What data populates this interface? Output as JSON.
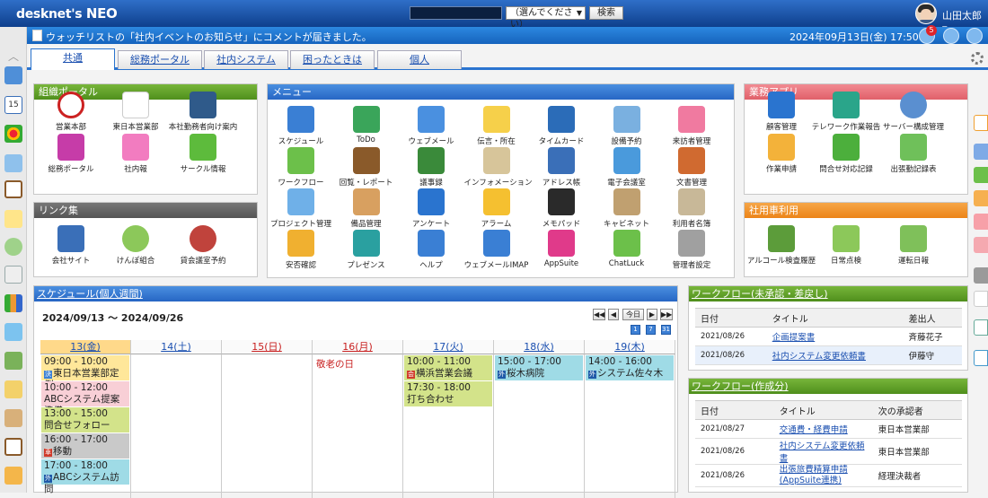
{
  "app": {
    "logo": "desknet's",
    "logo_neo": "NEO"
  },
  "search": {
    "select_value": "（選んでください）",
    "button": "検索"
  },
  "user": {
    "name": "山田太郎"
  },
  "notification": {
    "message": "ウォッチリストの「社内イベントのお知らせ」にコメントが届きました。",
    "datetime": "2024年09月13日(金) 17:50",
    "badge": "5"
  },
  "tabs": [
    "共通",
    "総務ポータル",
    "社内システム",
    "困ったときは",
    "個人"
  ],
  "org_portal": {
    "title": "組織ポータル",
    "items": [
      "営業本部",
      "東日本営業部",
      "本社勤務者向け案内",
      "総務ポータル",
      "社内報",
      "サークル情報"
    ]
  },
  "links": {
    "title": "リンク集",
    "items": [
      "会社サイト",
      "けんぽ組合",
      "貸会議室予約"
    ]
  },
  "menu": {
    "title": "メニュー",
    "items": [
      "スケジュール",
      "ToDo",
      "ウェブメール",
      "伝言・所在",
      "タイムカード",
      "設備予約",
      "来訪者管理",
      "ワークフロー",
      "回覧・レポート",
      "議事録",
      "インフォメーション",
      "アドレス帳",
      "電子会議室",
      "文書管理",
      "プロジェクト管理",
      "備品管理",
      "アンケート",
      "アラーム",
      "メモパッド",
      "キャビネット",
      "利用者名簿",
      "安否確認",
      "プレゼンス",
      "ヘルプ",
      "ウェブメールIMAP",
      "AppSuite",
      "ChatLuck",
      "管理者設定"
    ]
  },
  "business_apps": {
    "title": "業務アプリ",
    "items": [
      "顧客管理",
      "テレワーク作業報告",
      "サーバー構成管理",
      "作業申請",
      "問合せ対応記録",
      "出張勤記録表"
    ]
  },
  "company_car": {
    "title": "社用車利用",
    "items": [
      "アルコール検査履歴",
      "日常点検",
      "運転日報"
    ]
  },
  "schedule": {
    "title": "スケジュール(個人週間)",
    "range": "2024/09/13 ～ 2024/09/26",
    "nav": [
      "◀◀",
      "◀",
      "今日",
      "▶",
      "▶▶"
    ],
    "days": [
      "13(金)",
      "14(土)",
      "15(日)",
      "16(月)",
      "17(火)",
      "18(水)",
      "19(木)"
    ],
    "holiday_label": "敬老の日",
    "events": {
      "d0": [
        {
          "time": "09:00 - 10:00",
          "mark": "決",
          "title": "東日本営業部定例"
        },
        {
          "time": "10:00 - 12:00",
          "mark": "",
          "title": "ABCシステム提案準備"
        },
        {
          "time": "13:00 - 15:00",
          "mark": "",
          "title": "問合せフォロー"
        },
        {
          "time": "16:00 - 17:00",
          "mark": "車",
          "title": "移動"
        },
        {
          "time": "17:00 - 18:00",
          "mark": "外",
          "title": "ABCシステム訪問"
        }
      ],
      "d4": [
        {
          "time": "10:00 - 11:00",
          "mark": "会",
          "title": "横浜営業会議"
        },
        {
          "time": "17:30 - 18:00",
          "mark": "",
          "title": "打ち合わせ"
        }
      ],
      "d5": [
        {
          "time": "15:00 - 17:00",
          "mark": "外",
          "title": "桜木病院"
        }
      ],
      "d6": [
        {
          "time": "14:00 - 16:00",
          "mark": "外",
          "title": "システム佐々木"
        }
      ]
    }
  },
  "workflow_pending": {
    "title": "ワークフロー(未承認・差戻し)",
    "headers": [
      "日付",
      "タイトル",
      "差出人"
    ],
    "rows": [
      {
        "date": "2021/08/26",
        "title": "企画提案書",
        "from": "斉藤花子"
      },
      {
        "date": "2021/08/26",
        "title": "社内システム変更依頼書",
        "from": "伊藤守"
      }
    ]
  },
  "workflow_created": {
    "title": "ワークフロー(作成分)",
    "headers": [
      "日付",
      "タイトル",
      "次の承認者"
    ],
    "rows": [
      {
        "date": "2021/08/27",
        "title": "交通費・経費申請",
        "next": "東日本営業部"
      },
      {
        "date": "2021/08/26",
        "title": "社内システム変更依頼書",
        "next": "東日本営業部"
      },
      {
        "date": "2021/08/26",
        "title": "出張旅費精算申請 (AppSuite連携)",
        "next": "経理決裁者"
      }
    ]
  },
  "colors": {
    "header": "#1d4f9e",
    "accent_blue": "#2a74cf",
    "green": "#5e9e26",
    "pink": "#e86a73",
    "orange": "#ef8d22"
  }
}
